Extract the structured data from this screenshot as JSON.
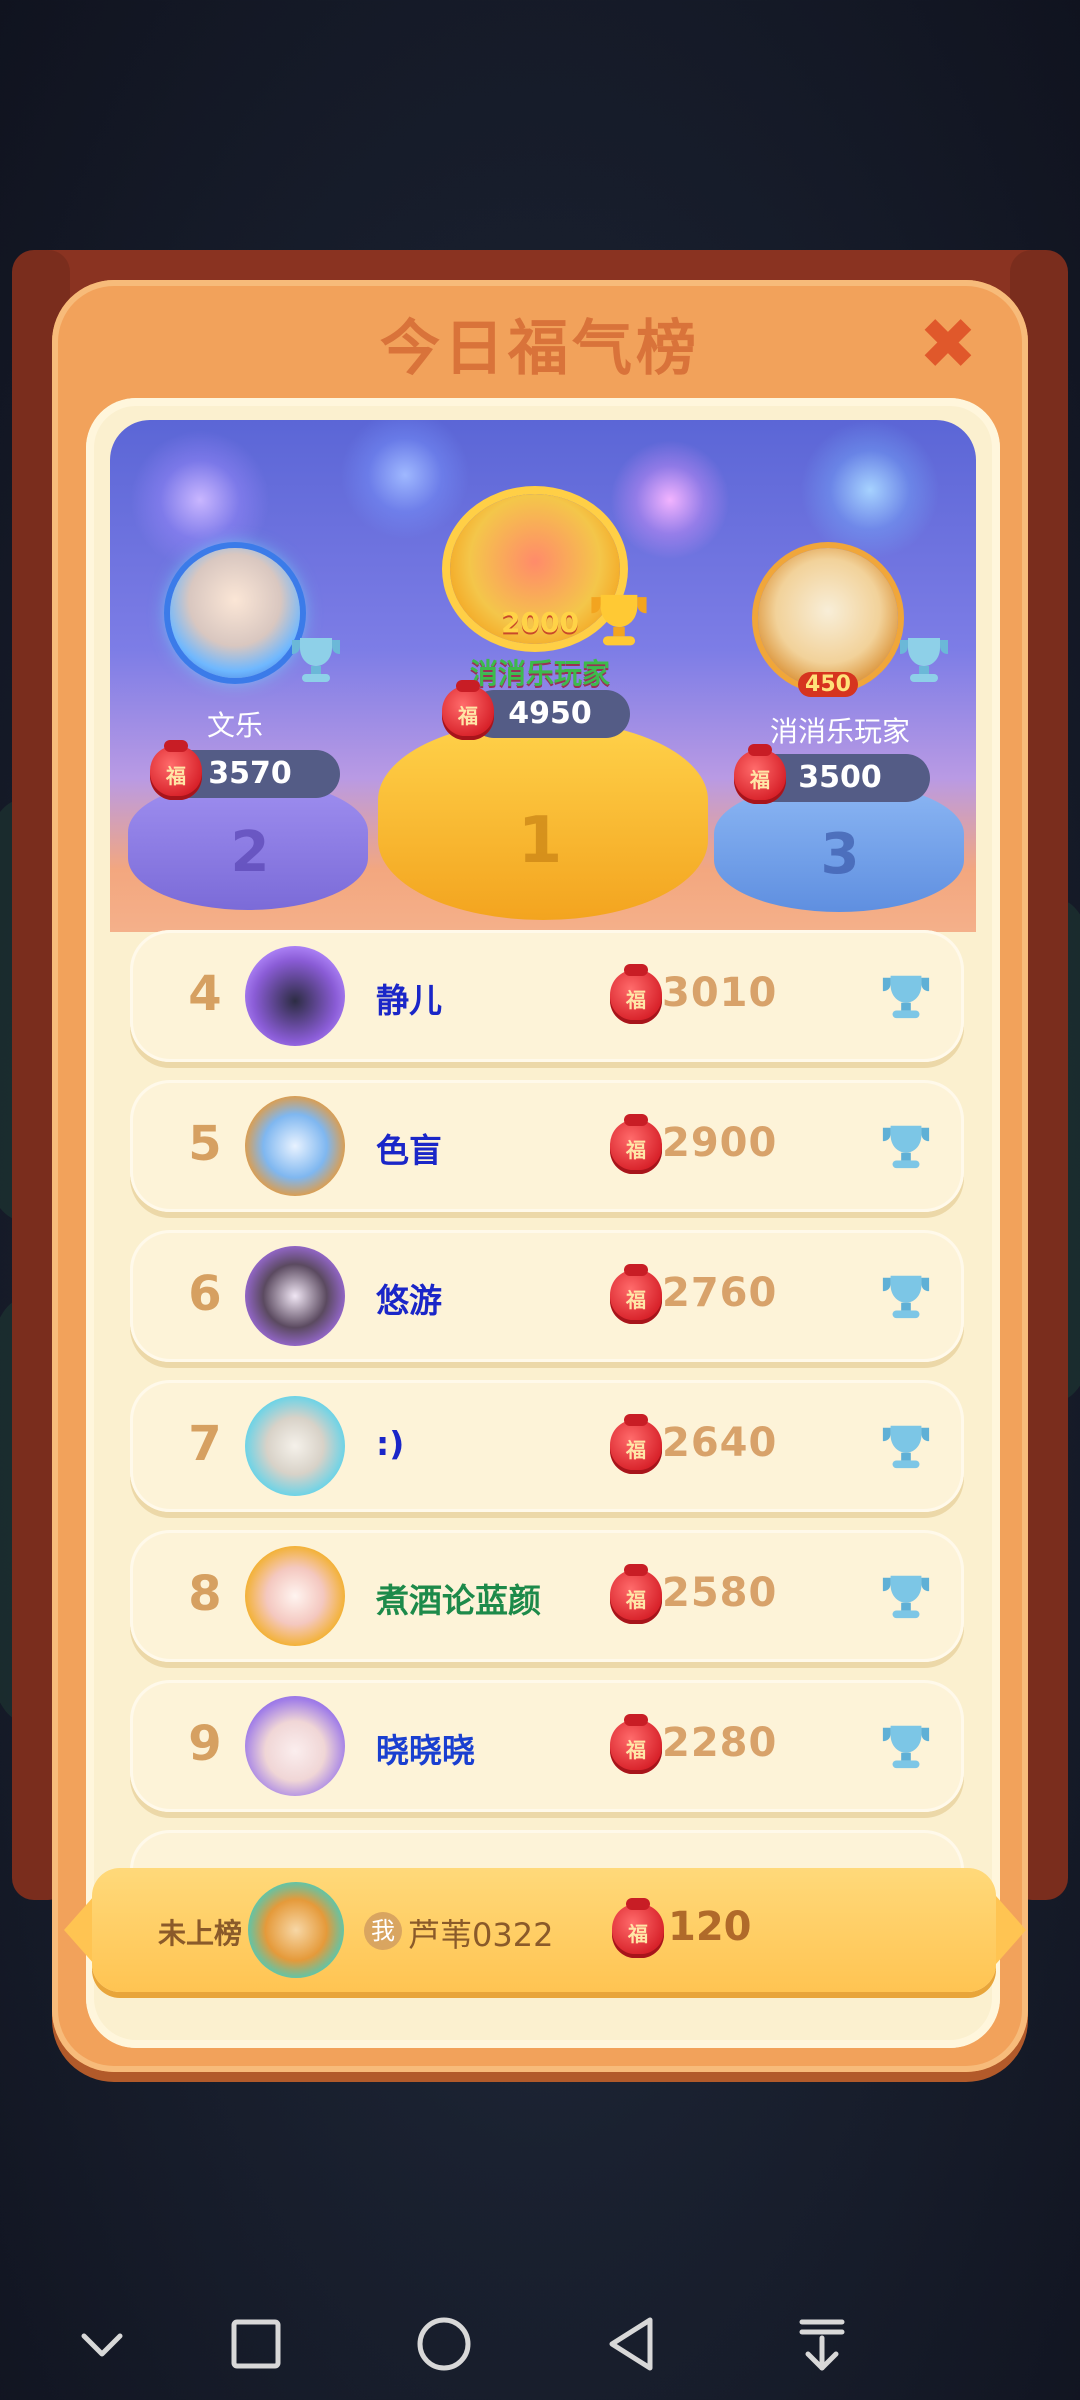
{
  "header": {
    "title": "今日福气榜",
    "close_label": "✖"
  },
  "bag_char": "福",
  "podium": [
    {
      "rank": "2",
      "name": "文乐",
      "score": "3570"
    },
    {
      "rank": "1",
      "name": "消消乐玩家",
      "score": "4950",
      "badge": "2000"
    },
    {
      "rank": "3",
      "name": "消消乐玩家",
      "score": "3500",
      "badge": "450"
    }
  ],
  "rows": [
    {
      "rank": "4",
      "name": "静儿",
      "score": "3010",
      "name_color": "#1a26c8"
    },
    {
      "rank": "5",
      "name": "色盲",
      "score": "2900",
      "name_color": "#1a26c8"
    },
    {
      "rank": "6",
      "name": "悠游",
      "score": "2760",
      "name_color": "#1a26c8"
    },
    {
      "rank": "7",
      "name": ":)",
      "score": "2640",
      "name_color": "#1a26c8"
    },
    {
      "rank": "8",
      "name": "煮酒论蓝颜",
      "score": "2580",
      "name_color": "#1d8a4a"
    },
    {
      "rank": "9",
      "name": "晓晓晓",
      "score": "2280",
      "name_color": "#1a3fd0"
    }
  ],
  "me": {
    "status": "未上榜",
    "me_tag": "我",
    "name": "芦苇0322",
    "score": "120"
  },
  "nav": [
    {
      "icon": "chevron-down-icon"
    },
    {
      "icon": "square-icon"
    },
    {
      "icon": "circle-home-icon"
    },
    {
      "icon": "back-triangle-icon"
    },
    {
      "icon": "download-icon"
    }
  ]
}
